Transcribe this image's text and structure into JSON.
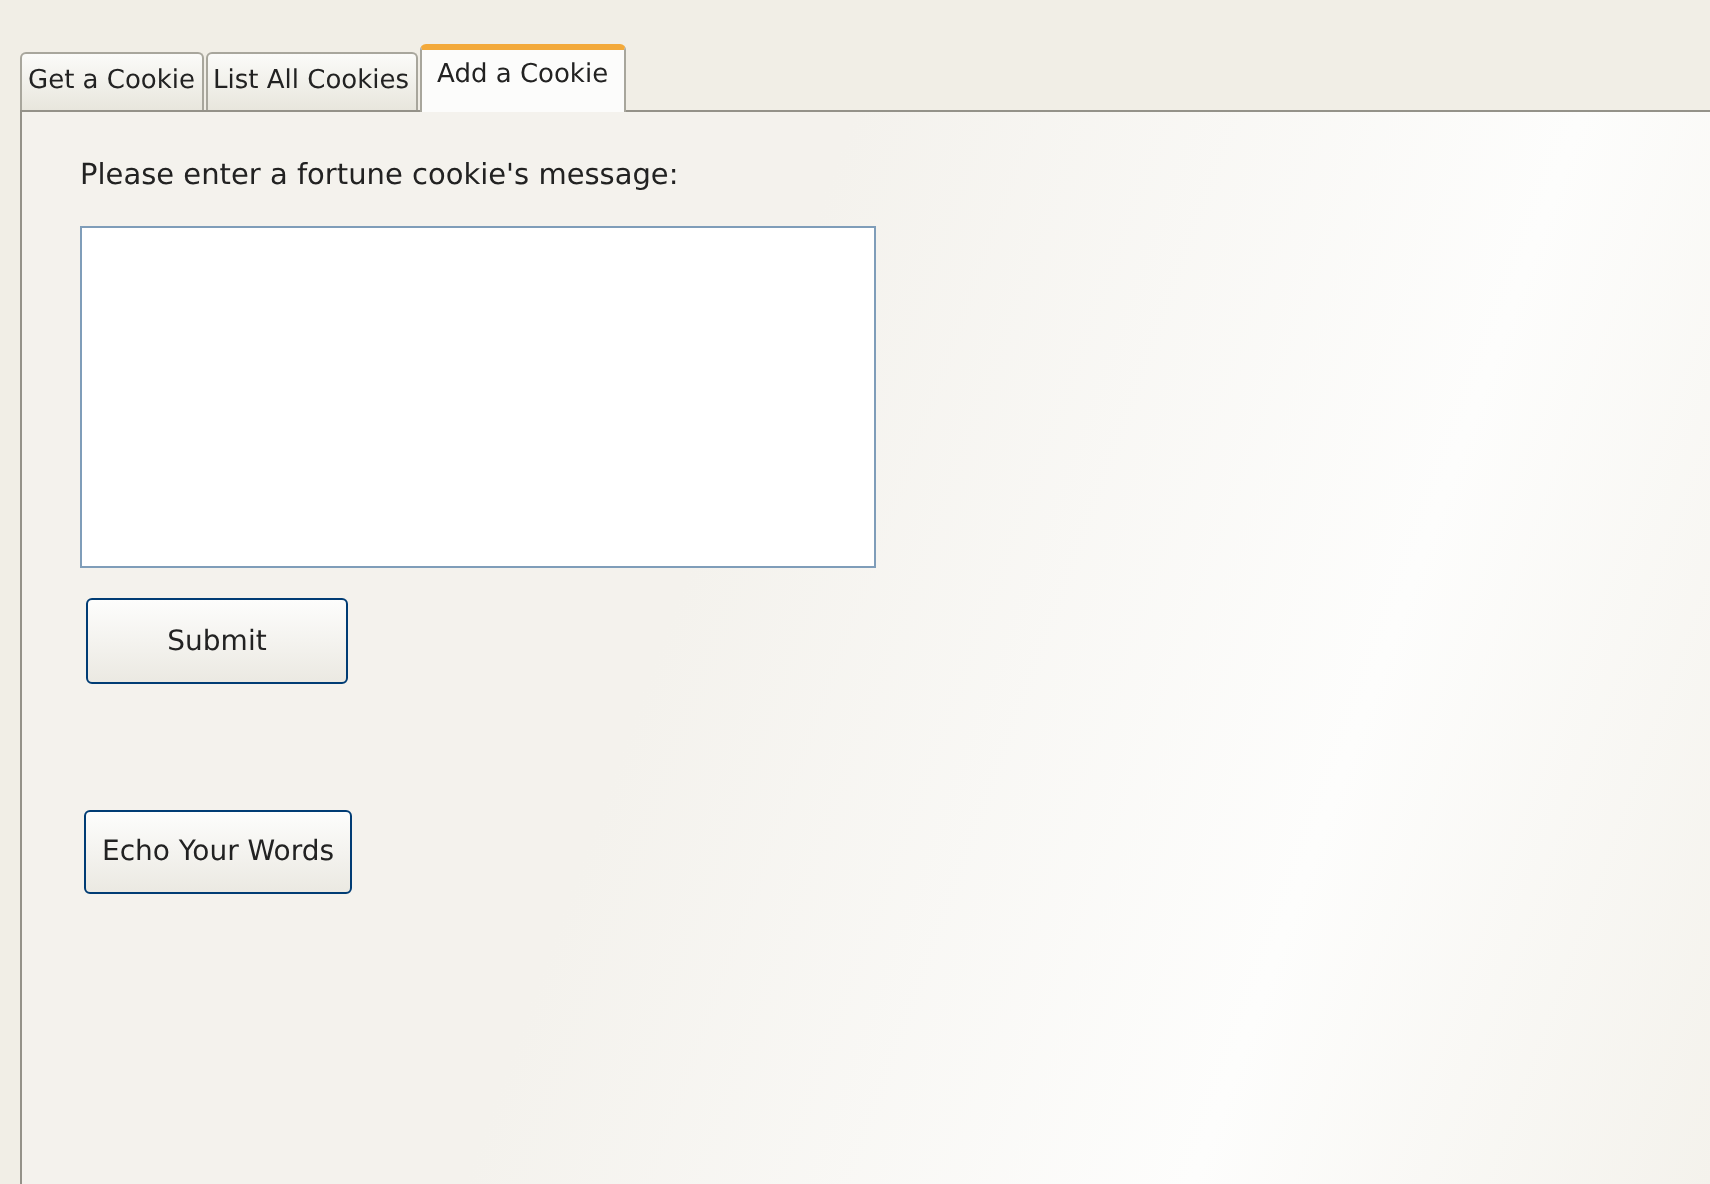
{
  "tabs": [
    {
      "label": "Get a Cookie",
      "selected": false
    },
    {
      "label": "List All Cookies",
      "selected": false
    },
    {
      "label": "Add a Cookie",
      "selected": true
    }
  ],
  "form": {
    "prompt": "Please enter a fortune cookie's message:",
    "submit": "Submit",
    "echo": "Echo Your Words"
  }
}
